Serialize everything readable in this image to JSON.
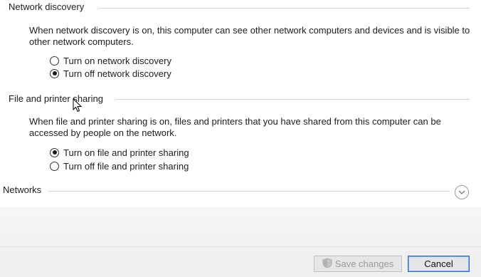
{
  "network_discovery": {
    "title": "Network discovery",
    "description": "When network discovery is on, this computer can see other network computers and devices and is visible to other network computers.",
    "options": [
      {
        "label": "Turn on network discovery",
        "checked": false
      },
      {
        "label": "Turn off network discovery",
        "checked": true
      }
    ]
  },
  "file_printer_sharing": {
    "title": "File and printer sharing",
    "description": "When file and printer sharing is on, files and printers that you have shared from this computer can be accessed by people on the network.",
    "options": [
      {
        "label": "Turn on file and printer sharing",
        "checked": true
      },
      {
        "label": "Turn off file and printer sharing",
        "checked": false
      }
    ]
  },
  "networks": {
    "title": "Networks",
    "expand_icon": "chevron-down-circle-icon"
  },
  "footer": {
    "save_label": "Save changes",
    "save_icon": "uac-shield-icon",
    "save_enabled": false,
    "cancel_label": "Cancel"
  }
}
